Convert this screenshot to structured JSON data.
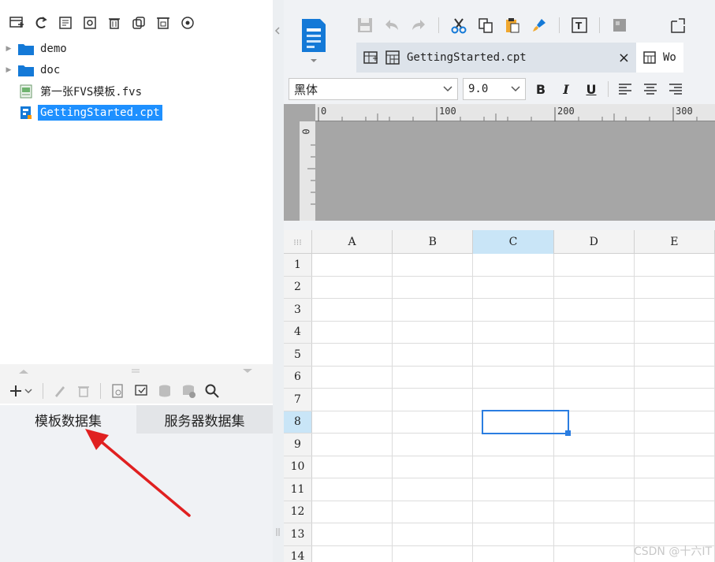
{
  "tree": {
    "items": [
      {
        "label": "demo",
        "type": "folder"
      },
      {
        "label": "doc",
        "type": "folder"
      },
      {
        "label": "第一张FVS模板.fvs",
        "type": "fvs"
      },
      {
        "label": "GettingStarted.cpt",
        "type": "cpt",
        "selected": true
      }
    ]
  },
  "dataset_tabs": {
    "template": "模板数据集",
    "server": "服务器数据集"
  },
  "file_tabs": {
    "active": "GettingStarted.cpt",
    "close": "×",
    "second": "Wo"
  },
  "format": {
    "font": "黑体",
    "size": "9.0",
    "bold": "B",
    "italic": "I",
    "underline": "U"
  },
  "ruler": {
    "h_ticks": [
      "0",
      "100",
      "200",
      "300"
    ],
    "v_tick": "0"
  },
  "grid": {
    "columns": [
      "A",
      "B",
      "C",
      "D",
      "E"
    ],
    "rows": [
      "1",
      "2",
      "3",
      "4",
      "5",
      "6",
      "7",
      "8",
      "9",
      "10",
      "11",
      "12",
      "13",
      "14"
    ],
    "active_column": "C",
    "active_row": "8"
  },
  "watermark": "CSDN @十六IT",
  "colors": {
    "accent": "#1e90ff",
    "selection": "#2a7de1",
    "arrow": "#e02020"
  }
}
